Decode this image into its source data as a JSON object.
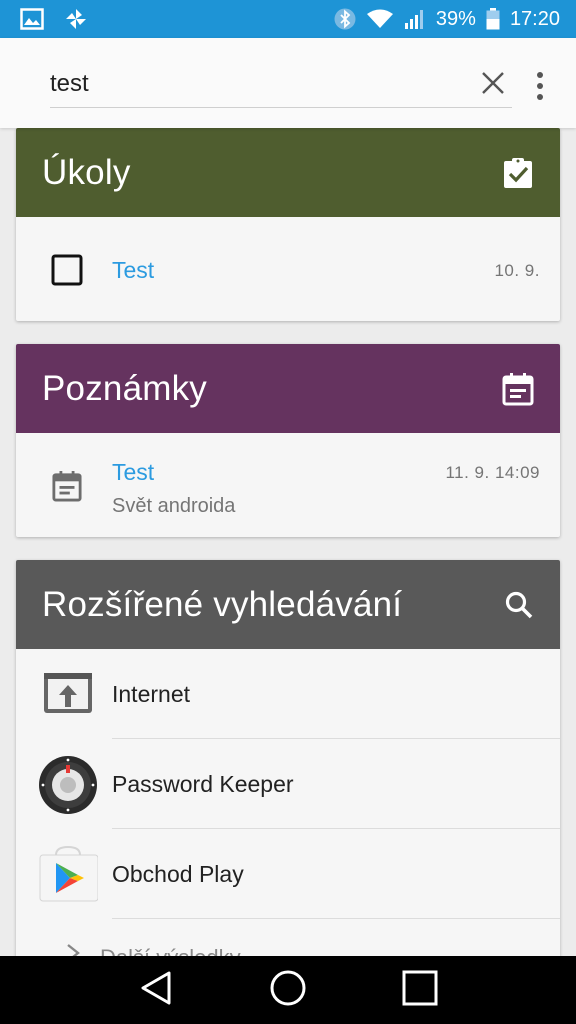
{
  "status_bar": {
    "battery_percent": "39%",
    "time": "17:20",
    "icons": [
      "gallery-icon",
      "pinwheel-icon",
      "bluetooth-icon",
      "wifi-icon",
      "signal-icon",
      "battery-icon"
    ]
  },
  "search": {
    "value": "test",
    "clear_icon": "close-icon",
    "menu_icon": "more-vert-icon"
  },
  "tasks": {
    "title": "Úkoly",
    "header_icon": "clipboard-check-icon",
    "header_color": "#4f5d2f",
    "items": [
      {
        "title": "Test",
        "date": "10. 9.",
        "icon": "checkbox-icon"
      }
    ]
  },
  "notes": {
    "title": "Poznámky",
    "header_icon": "calendar-note-icon",
    "header_color": "#65335f",
    "items": [
      {
        "title": "Test",
        "subtitle": "Svět androida",
        "date": "11. 9. 14:09",
        "icon": "calendar-note-icon"
      }
    ]
  },
  "advanced": {
    "title": "Rozšířené vyhledávání",
    "header_icon": "search-icon",
    "header_color": "#595959",
    "apps": [
      {
        "label": "Internet",
        "icon": "internet-browser-icon"
      },
      {
        "label": "Password Keeper",
        "icon": "password-keeper-icon"
      },
      {
        "label": "Obchod Play",
        "icon": "play-store-icon"
      }
    ],
    "more_label": "Další výsledky"
  },
  "accent_color": "#2c9be0",
  "nav_bar": {
    "icons": [
      "back-icon",
      "home-icon",
      "recents-icon"
    ]
  }
}
